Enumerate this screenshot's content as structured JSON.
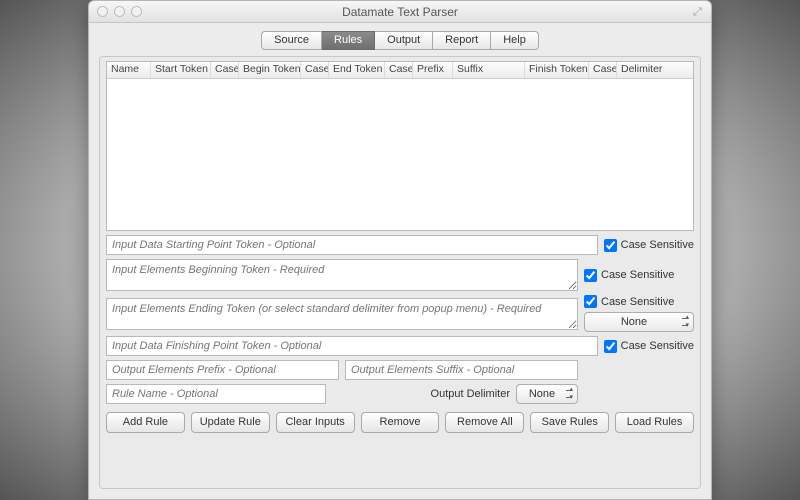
{
  "window": {
    "title": "Datamate Text Parser"
  },
  "tabs": [
    {
      "label": "Source",
      "active": false
    },
    {
      "label": "Rules",
      "active": true
    },
    {
      "label": "Output",
      "active": false
    },
    {
      "label": "Report",
      "active": false
    },
    {
      "label": "Help",
      "active": false
    }
  ],
  "table": {
    "columns": [
      "Name",
      "Start Token",
      "Case",
      "Begin Token",
      "Case",
      "End Token",
      "Case",
      "Prefix",
      "Suffix",
      "Finish Token",
      "Case",
      "Delimiter"
    ],
    "rows": []
  },
  "fields": {
    "start_token": {
      "placeholder": "Input Data Starting Point Token - Optional",
      "case_label": "Case Sensitive",
      "case_checked": true
    },
    "begin_token": {
      "placeholder": "Input Elements Beginning Token - Required",
      "case_label": "Case Sensitive",
      "case_checked": true
    },
    "end_token": {
      "placeholder": "Input Elements Ending Token (or select standard delimiter from popup menu) - Required",
      "case_label": "Case Sensitive",
      "case_checked": true,
      "delimiter_select": "None"
    },
    "finish_token": {
      "placeholder": "Input Data Finishing Point Token - Optional",
      "case_label": "Case Sensitive",
      "case_checked": true
    },
    "prefix": {
      "placeholder": "Output Elements Prefix - Optional"
    },
    "suffix": {
      "placeholder": "Output Elements Suffix - Optional"
    },
    "rule_name": {
      "placeholder": "Rule Name - Optional"
    }
  },
  "output_delimiter": {
    "label": "Output Delimiter",
    "value": "None"
  },
  "buttons": {
    "add": "Add Rule",
    "update": "Update Rule",
    "clear": "Clear Inputs",
    "remove": "Remove",
    "remove_all": "Remove All",
    "save": "Save Rules",
    "load": "Load Rules"
  }
}
